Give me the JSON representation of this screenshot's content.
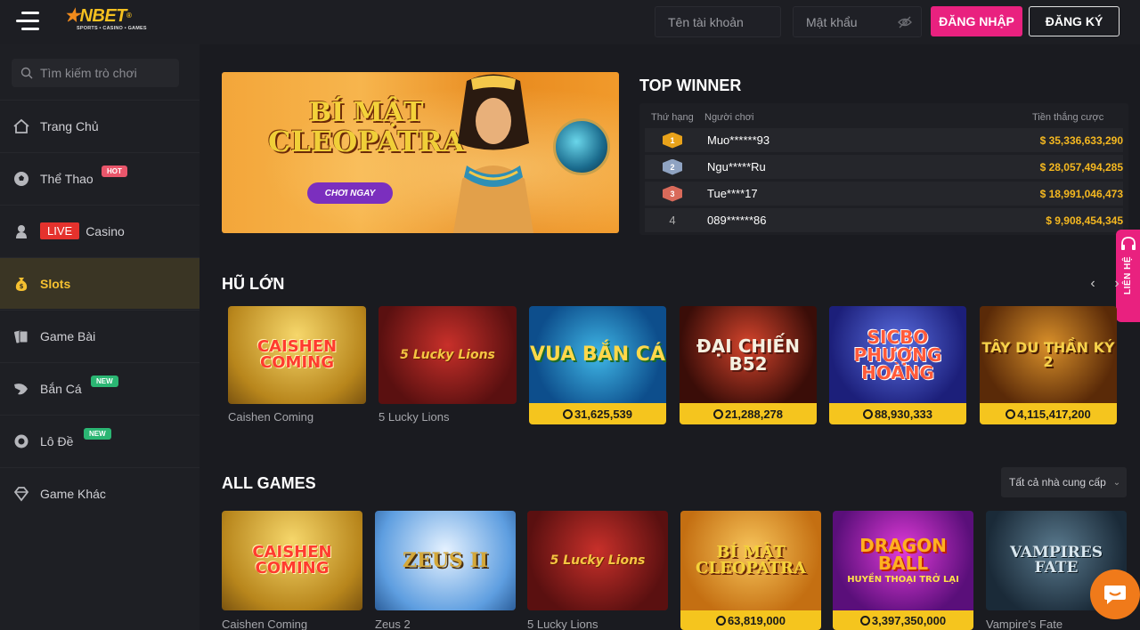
{
  "header": {
    "username_placeholder": "Tên tài khoản",
    "password_placeholder": "Mật khẩu",
    "login_label": "ĐĂNG NHẬP",
    "register_label": "ĐĂNG KÝ",
    "logo_text": "NBET",
    "logo_sub": "SPORTS • CASINO • GAMES"
  },
  "sidebar": {
    "search_placeholder": "Tìm kiếm trò chơi",
    "items": [
      {
        "label": "Trang Chủ",
        "icon": "home-icon"
      },
      {
        "label": "Thể Thao",
        "icon": "soccer-ball-icon",
        "badge": "HOT"
      },
      {
        "label": "Casino",
        "icon": "dealer-icon",
        "live": "LIVE"
      },
      {
        "label": "Slots",
        "icon": "money-bag-icon"
      },
      {
        "label": "Game Bài",
        "icon": "cards-icon"
      },
      {
        "label": "Bắn Cá",
        "icon": "fish-icon",
        "badge": "NEW"
      },
      {
        "label": "Lô Đề",
        "icon": "lottery-ball-icon",
        "badge": "NEW"
      },
      {
        "label": "Game Khác",
        "icon": "diamond-icon"
      }
    ]
  },
  "banner": {
    "title_1": "BÍ MẬT",
    "title_2": "CLEOPATRA",
    "button": "CHƠI NGAY"
  },
  "top_winner": {
    "title": "TOP WINNER",
    "col_rank": "Thứ hạng",
    "col_player": "Người chơi",
    "col_amount": "Tiền thắng cược",
    "rows": [
      {
        "rank": "1",
        "player": "Muo******93",
        "amount": "$  35,336,633,290"
      },
      {
        "rank": "2",
        "player": "Ngu*****Ru",
        "amount": "$  28,057,494,285"
      },
      {
        "rank": "3",
        "player": "Tue****17",
        "amount": "$  18,991,046,473"
      },
      {
        "rank": "4",
        "player": "089******86",
        "amount": "$  9,908,454,345"
      }
    ]
  },
  "jackpot_section": {
    "title": "HŨ LỚN",
    "games": [
      {
        "name": "Caishen Coming",
        "art": "CAISHEN COMING"
      },
      {
        "name": "5 Lucky Lions",
        "art": "5 Lucky Lions"
      },
      {
        "art": "VUA BẮN CÁ",
        "jackpot": "31,625,539"
      },
      {
        "art": "ĐẠI CHIẾN B52",
        "jackpot": "21,288,278"
      },
      {
        "art": "SICBO PHƯỢNG HOÀNG",
        "jackpot": "88,930,333"
      },
      {
        "art": "TÂY DU THẦN KÝ 2",
        "jackpot": "4,115,417,200"
      }
    ]
  },
  "all_games": {
    "title": "ALL GAMES",
    "provider_select": "Tất cả nhà cung cấp",
    "games": [
      {
        "name": "Caishen Coming",
        "art": "CAISHEN COMING"
      },
      {
        "name": "Zeus 2",
        "art": "ZEUS II"
      },
      {
        "name": "5 Lucky Lions",
        "art": "5 Lucky Lions"
      },
      {
        "art": "BÍ MẬT CLEOPATRA",
        "jackpot": "63,819,000"
      },
      {
        "art": "DRAGON BALL",
        "art_sub": "HUYỀN THOẠI TRỞ LẠI",
        "jackpot": "3,397,350,000"
      },
      {
        "name": "Vampire's Fate",
        "art": "VAMPIRES FATE"
      }
    ]
  },
  "contact": {
    "label": "LIÊN HỆ"
  }
}
